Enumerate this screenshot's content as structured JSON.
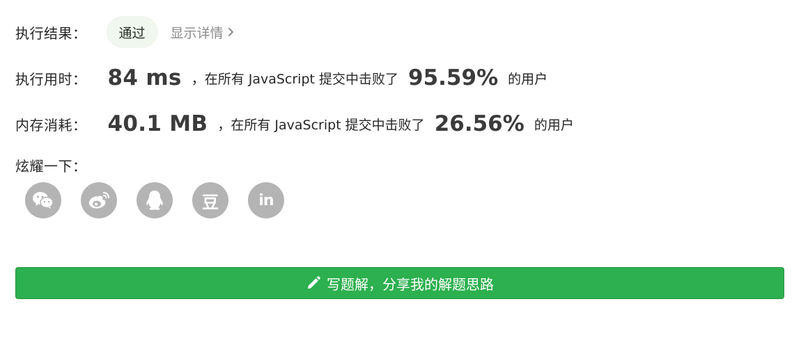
{
  "result": {
    "label": "执行结果：",
    "status": "通过",
    "details_link": "显示详情"
  },
  "runtime": {
    "label": "执行用时：",
    "value": "84 ms",
    "middle_text": "，在所有 JavaScript 提交中击败了",
    "percent": "95.59%",
    "tail_text": "的用户"
  },
  "memory": {
    "label": "内存消耗：",
    "value": "40.1 MB",
    "middle_text": "，在所有 JavaScript 提交中击败了",
    "percent": "26.56%",
    "tail_text": "的用户"
  },
  "share": {
    "label": "炫耀一下：",
    "icons": [
      "wechat-icon",
      "weibo-icon",
      "qq-icon",
      "douban-icon",
      "linkedin-icon"
    ],
    "douban_glyph": "豆",
    "linkedin_glyph": "in"
  },
  "solution_button": {
    "label": "写题解，分享我的解题思路",
    "icon": "pencil-icon"
  },
  "colors": {
    "accent_green": "#2db04f",
    "badge_bg": "#f0f7ee",
    "icon_gray": "#b4b4b4",
    "muted_text": "#8c8c8c"
  }
}
